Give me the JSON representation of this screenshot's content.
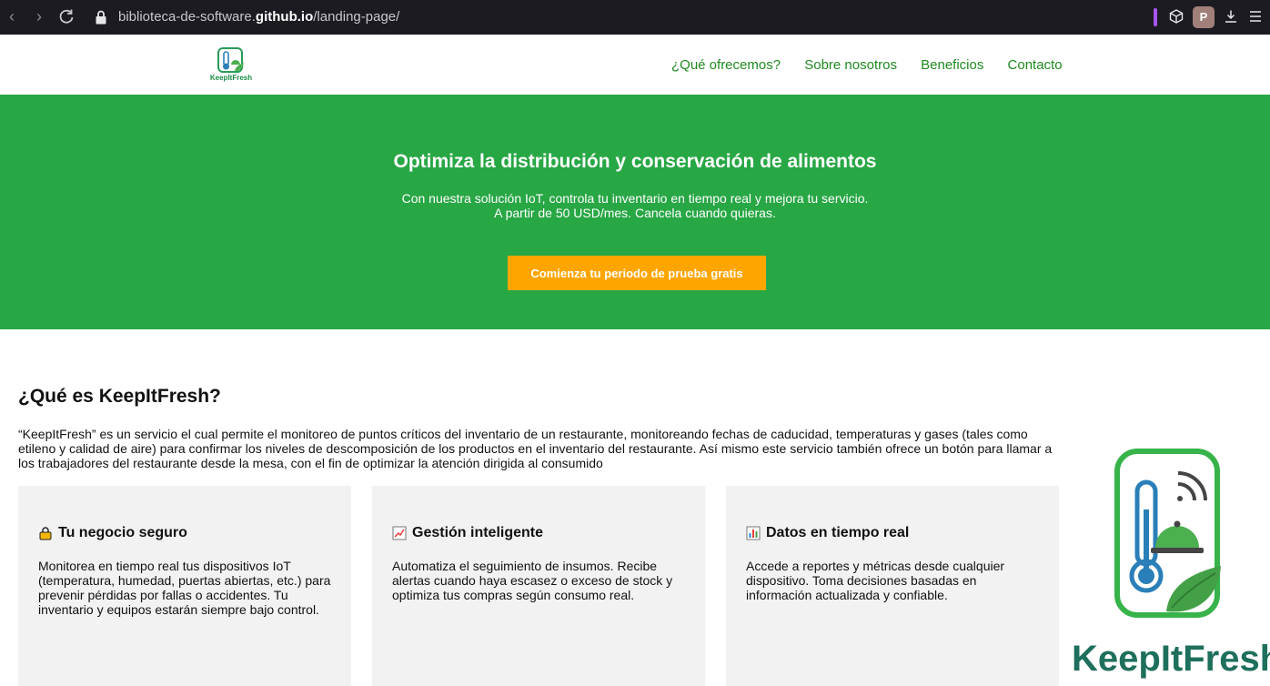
{
  "browser": {
    "url_prefix": "biblioteca-de-software.",
    "url_domain": "github.io",
    "url_path": "/landing-page/",
    "profile_initial": "P"
  },
  "header": {
    "logo_text": "KeepItFresh",
    "nav": [
      "¿Qué ofrecemos?",
      "Sobre nosotros",
      "Beneficios",
      "Contacto"
    ]
  },
  "hero": {
    "title": "Optimiza la distribución y conservación de alimentos",
    "line1": "Con nuestra solución IoT, controla tu inventario en tiempo real y mejora tu servicio.",
    "line2": "A partir de 50 USD/mes. Cancela cuando quieras.",
    "cta": "Comienza tu periodo de prueba gratis"
  },
  "about": {
    "title": "¿Qué es KeepItFresh?",
    "text": "“KeepItFresh” es un servicio el cual permite el monitoreo de puntos críticos del inventario de un restaurante, monitoreando fechas de caducidad, temperaturas y gases (tales como etileno y calidad de aire) para confirmar los niveles de descomposición de los productos en el inventario del restaurante. Así mismo este servicio también ofrece un botón para llamar a los trabajadores del restaurante desde la mesa, con el fin de optimizar la atención dirigida al consumido",
    "logo_text": "KeepItFresh"
  },
  "cards": [
    {
      "icon": "lock-icon",
      "title": "Tu negocio seguro",
      "text": "Monitorea en tiempo real tus dispositivos IoT (temperatura, humedad, puertas abiertas, etc.) para prevenir pérdidas por fallas o accidentes. Tu inventario y equipos estarán siempre bajo control."
    },
    {
      "icon": "trend-chart-icon",
      "title": "Gestión inteligente",
      "text": "Automatiza el seguimiento de insumos. Recibe alertas cuando haya escasez o exceso de stock y optimiza tus compras según consumo real."
    },
    {
      "icon": "bar-chart-icon",
      "title": "Datos en tiempo real",
      "text": "Accede a reportes y métricas desde cualquier dispositivo. Toma decisiones basadas en información actualizada y confiable."
    }
  ],
  "colors": {
    "hero_green": "#28a745",
    "nav_green": "#1f8a1f",
    "cta_orange": "#ffa500",
    "card_bg": "#f2f2f2"
  }
}
